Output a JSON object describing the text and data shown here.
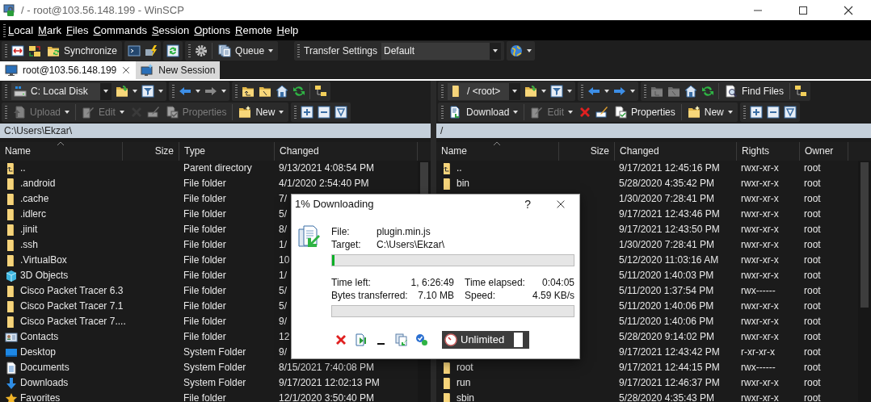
{
  "window": {
    "title": "/ - root@103.56.148.199 - WinSCP"
  },
  "menu": [
    "Local",
    "Mark",
    "Files",
    "Commands",
    "Session",
    "Options",
    "Remote",
    "Help"
  ],
  "toolbar": {
    "synchronize": "Synchronize",
    "queue": "Queue",
    "transfer_settings": "Transfer Settings",
    "preset": "Default"
  },
  "tabs": [
    {
      "label": "root@103.56.148.199",
      "selected": true
    },
    {
      "label": "New Session",
      "selected": false
    }
  ],
  "local_panel": {
    "location": "C: Local Disk",
    "buttons": [
      {
        "label": "Upload",
        "disabled": true
      },
      {
        "label": "Edit",
        "disabled": true
      },
      {
        "label": "Properties",
        "disabled": true
      },
      {
        "label": "New",
        "disabled": false
      }
    ],
    "path": "C:\\Users\\Ekzar\\",
    "columns": [
      "Name",
      "Size",
      "Type",
      "Changed"
    ],
    "rows": [
      {
        "kind": "up",
        "name": "..",
        "type": "Parent directory",
        "changed": "9/13/2021 4:08:54 PM"
      },
      {
        "kind": "folder",
        "name": ".android",
        "type": "File folder",
        "changed": "4/1/2020 2:54:40 PM"
      },
      {
        "kind": "folder",
        "name": ".cache",
        "type": "File folder",
        "changed": "7/"
      },
      {
        "kind": "folder",
        "name": ".idlerc",
        "type": "File folder",
        "changed": "5/"
      },
      {
        "kind": "folder",
        "name": ".jinit",
        "type": "File folder",
        "changed": "8/"
      },
      {
        "kind": "folder",
        "name": ".ssh",
        "type": "File folder",
        "changed": "1/"
      },
      {
        "kind": "folder",
        "name": ".VirtualBox",
        "type": "File folder",
        "changed": "10"
      },
      {
        "kind": "cube",
        "name": "3D Objects",
        "type": "File folder",
        "changed": "1/"
      },
      {
        "kind": "folder",
        "name": "Cisco Packet Tracer 6.3",
        "type": "File folder",
        "changed": "5/"
      },
      {
        "kind": "folder",
        "name": "Cisco Packet Tracer 7.1",
        "type": "File folder",
        "changed": "5/"
      },
      {
        "kind": "folder",
        "name": "Cisco Packet Tracer 7....",
        "type": "File folder",
        "changed": "9/"
      },
      {
        "kind": "contact",
        "name": "Contacts",
        "type": "File folder",
        "changed": "12"
      },
      {
        "kind": "desktop",
        "name": "Desktop",
        "type": "System Folder",
        "changed": "9/"
      },
      {
        "kind": "document",
        "name": "Documents",
        "type": "System Folder",
        "changed": "8/15/2021 7:40:08 PM"
      },
      {
        "kind": "download",
        "name": "Downloads",
        "type": "System Folder",
        "changed": "9/17/2021 12:02:13 PM"
      },
      {
        "kind": "star",
        "name": "Favorites",
        "type": "File folder",
        "changed": "12/1/2020 3:50:40 PM"
      }
    ]
  },
  "remote_panel": {
    "location": "/ <root>",
    "find": "Find Files",
    "buttons": [
      {
        "label": "Download",
        "disabled": false
      },
      {
        "label": "Edit",
        "disabled": true
      },
      {
        "label": "Properties",
        "disabled": false
      },
      {
        "label": "New",
        "disabled": false
      }
    ],
    "path": "/",
    "columns": [
      "Name",
      "Size",
      "Changed",
      "Rights",
      "Owner"
    ],
    "rows": [
      {
        "kind": "up",
        "name": "..",
        "changed": "9/17/2021 12:45:16 PM",
        "rights": "rwxr-xr-x",
        "owner": "root"
      },
      {
        "kind": "folder",
        "name": "bin",
        "changed": "5/28/2020 4:35:42 PM",
        "rights": "rwxr-xr-x",
        "owner": "root"
      },
      {
        "changed": "1/30/2020 7:28:41 PM",
        "rights": "rwxr-xr-x",
        "owner": "root"
      },
      {
        "changed": "9/17/2021 12:43:46 PM",
        "rights": "rwxr-xr-x",
        "owner": "root"
      },
      {
        "changed": "9/17/2021 12:43:50 PM",
        "rights": "rwxr-xr-x",
        "owner": "root"
      },
      {
        "changed": "1/30/2020 7:28:41 PM",
        "rights": "rwxr-xr-x",
        "owner": "root"
      },
      {
        "changed": "5/12/2020 11:03:16 AM",
        "rights": "rwxr-xr-x",
        "owner": "root"
      },
      {
        "changed": "5/11/2020 1:40:03 PM",
        "rights": "rwxr-xr-x",
        "owner": "root"
      },
      {
        "changed": "5/11/2020 1:37:54 PM",
        "rights": "rwx------",
        "owner": "root"
      },
      {
        "changed": "5/11/2020 1:40:06 PM",
        "rights": "rwxr-xr-x",
        "owner": "root"
      },
      {
        "changed": "5/11/2020 1:40:06 PM",
        "rights": "rwxr-xr-x",
        "owner": "root"
      },
      {
        "changed": "5/28/2020 9:14:02 PM",
        "rights": "rwxr-xr-x",
        "owner": "root"
      },
      {
        "changed": "9/17/2021 12:43:42 PM",
        "rights": "r-xr-xr-x",
        "owner": "root"
      },
      {
        "kind": "folder",
        "name": "root",
        "changed": "9/17/2021 12:44:15 PM",
        "rights": "rwx------",
        "owner": "root"
      },
      {
        "kind": "folder",
        "name": "run",
        "changed": "9/17/2021 12:46:37 PM",
        "rights": "rwxr-xr-x",
        "owner": "root"
      },
      {
        "kind": "folder",
        "name": "sbin",
        "changed": "5/28/2020 4:35:43 PM",
        "rights": "rwxr-xr-x",
        "owner": "root"
      }
    ]
  },
  "dialog": {
    "title": "1% Downloading",
    "help": "?",
    "file_label": "File:",
    "file": "plugin.min.js",
    "target_label": "Target:",
    "target": "C:\\Users\\Ekzar\\",
    "level": 0.01,
    "stats": [
      {
        "label": "Time left:",
        "value": "1, 6:26:49"
      },
      {
        "label": "Time elapsed:",
        "value": "0:04:05"
      },
      {
        "label": "Bytes transferred:",
        "value": "7.10 MB"
      },
      {
        "label": "Speed:",
        "value": "4.59 KB/s"
      }
    ],
    "file_progress": {
      "level": 0
    },
    "speed_limit": "Unlimited"
  }
}
